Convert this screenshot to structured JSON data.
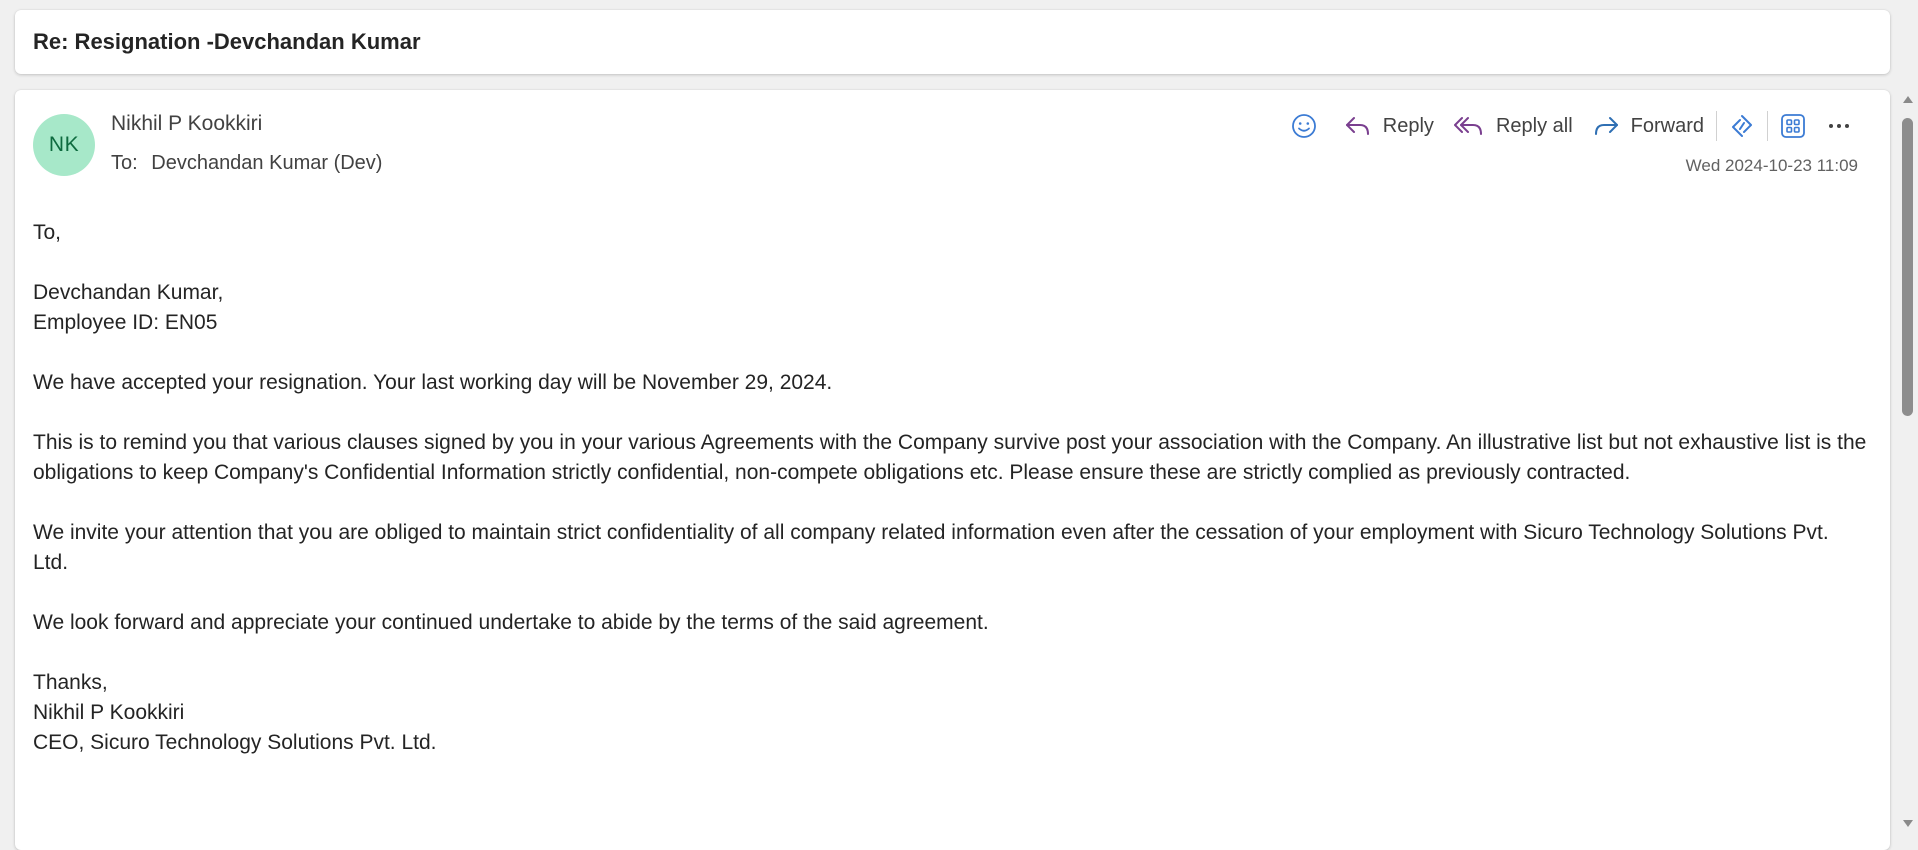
{
  "subject": "Re: Resignation -Devchandan Kumar",
  "message": {
    "avatar_initials": "NK",
    "sender_name": "Nikhil P Kookkiri",
    "to_label": "To:",
    "recipient": "Devchandan Kumar (Dev)",
    "timestamp": "Wed 2024-10-23 11:09",
    "actions": {
      "reply": "Reply",
      "reply_all": "Reply all",
      "forward": "Forward"
    },
    "icons": {
      "emoji": "smiley-icon",
      "reply": "reply-arrow-icon",
      "reply_all": "reply-all-arrow-icon",
      "forward": "forward-arrow-icon",
      "copilot": "loop-icon",
      "apps": "apps-grid-icon",
      "more": "more-dots-icon"
    },
    "body": {
      "greeting": "To,",
      "recipient_name": "Devchandan Kumar,",
      "employee_id": "Employee ID: EN05",
      "para1": "We have accepted your resignation. Your last working day will be November 29, 2024.",
      "para2": "This is to remind you that various clauses signed by you in your various Agreements with the Company survive post your association with the Company. An illustrative list but not exhaustive list is the obligations to keep Company's Confidential Information strictly confidential, non-compete obligations etc. Please ensure these are strictly complied as previously contracted.",
      "para3": "We invite your attention that you are obliged to maintain strict confidentiality of all company related information even after the cessation of your employment with Sicuro Technology Solutions Pvt. Ltd.",
      "para4": "We look forward and appreciate your continued undertake to abide by the terms of the said agreement.",
      "signoff": "Thanks,",
      "signature_name": "Nikhil P Kookkiri",
      "signature_title": "CEO, Sicuro Technology Solutions Pvt. Ltd."
    }
  },
  "colors": {
    "avatar_bg": "#a7e8c9",
    "avatar_text": "#0e6b3f",
    "reply_icon": "#7a3f8f",
    "forward_icon": "#2f6fb3",
    "accent_blue": "#3b7bd4"
  }
}
